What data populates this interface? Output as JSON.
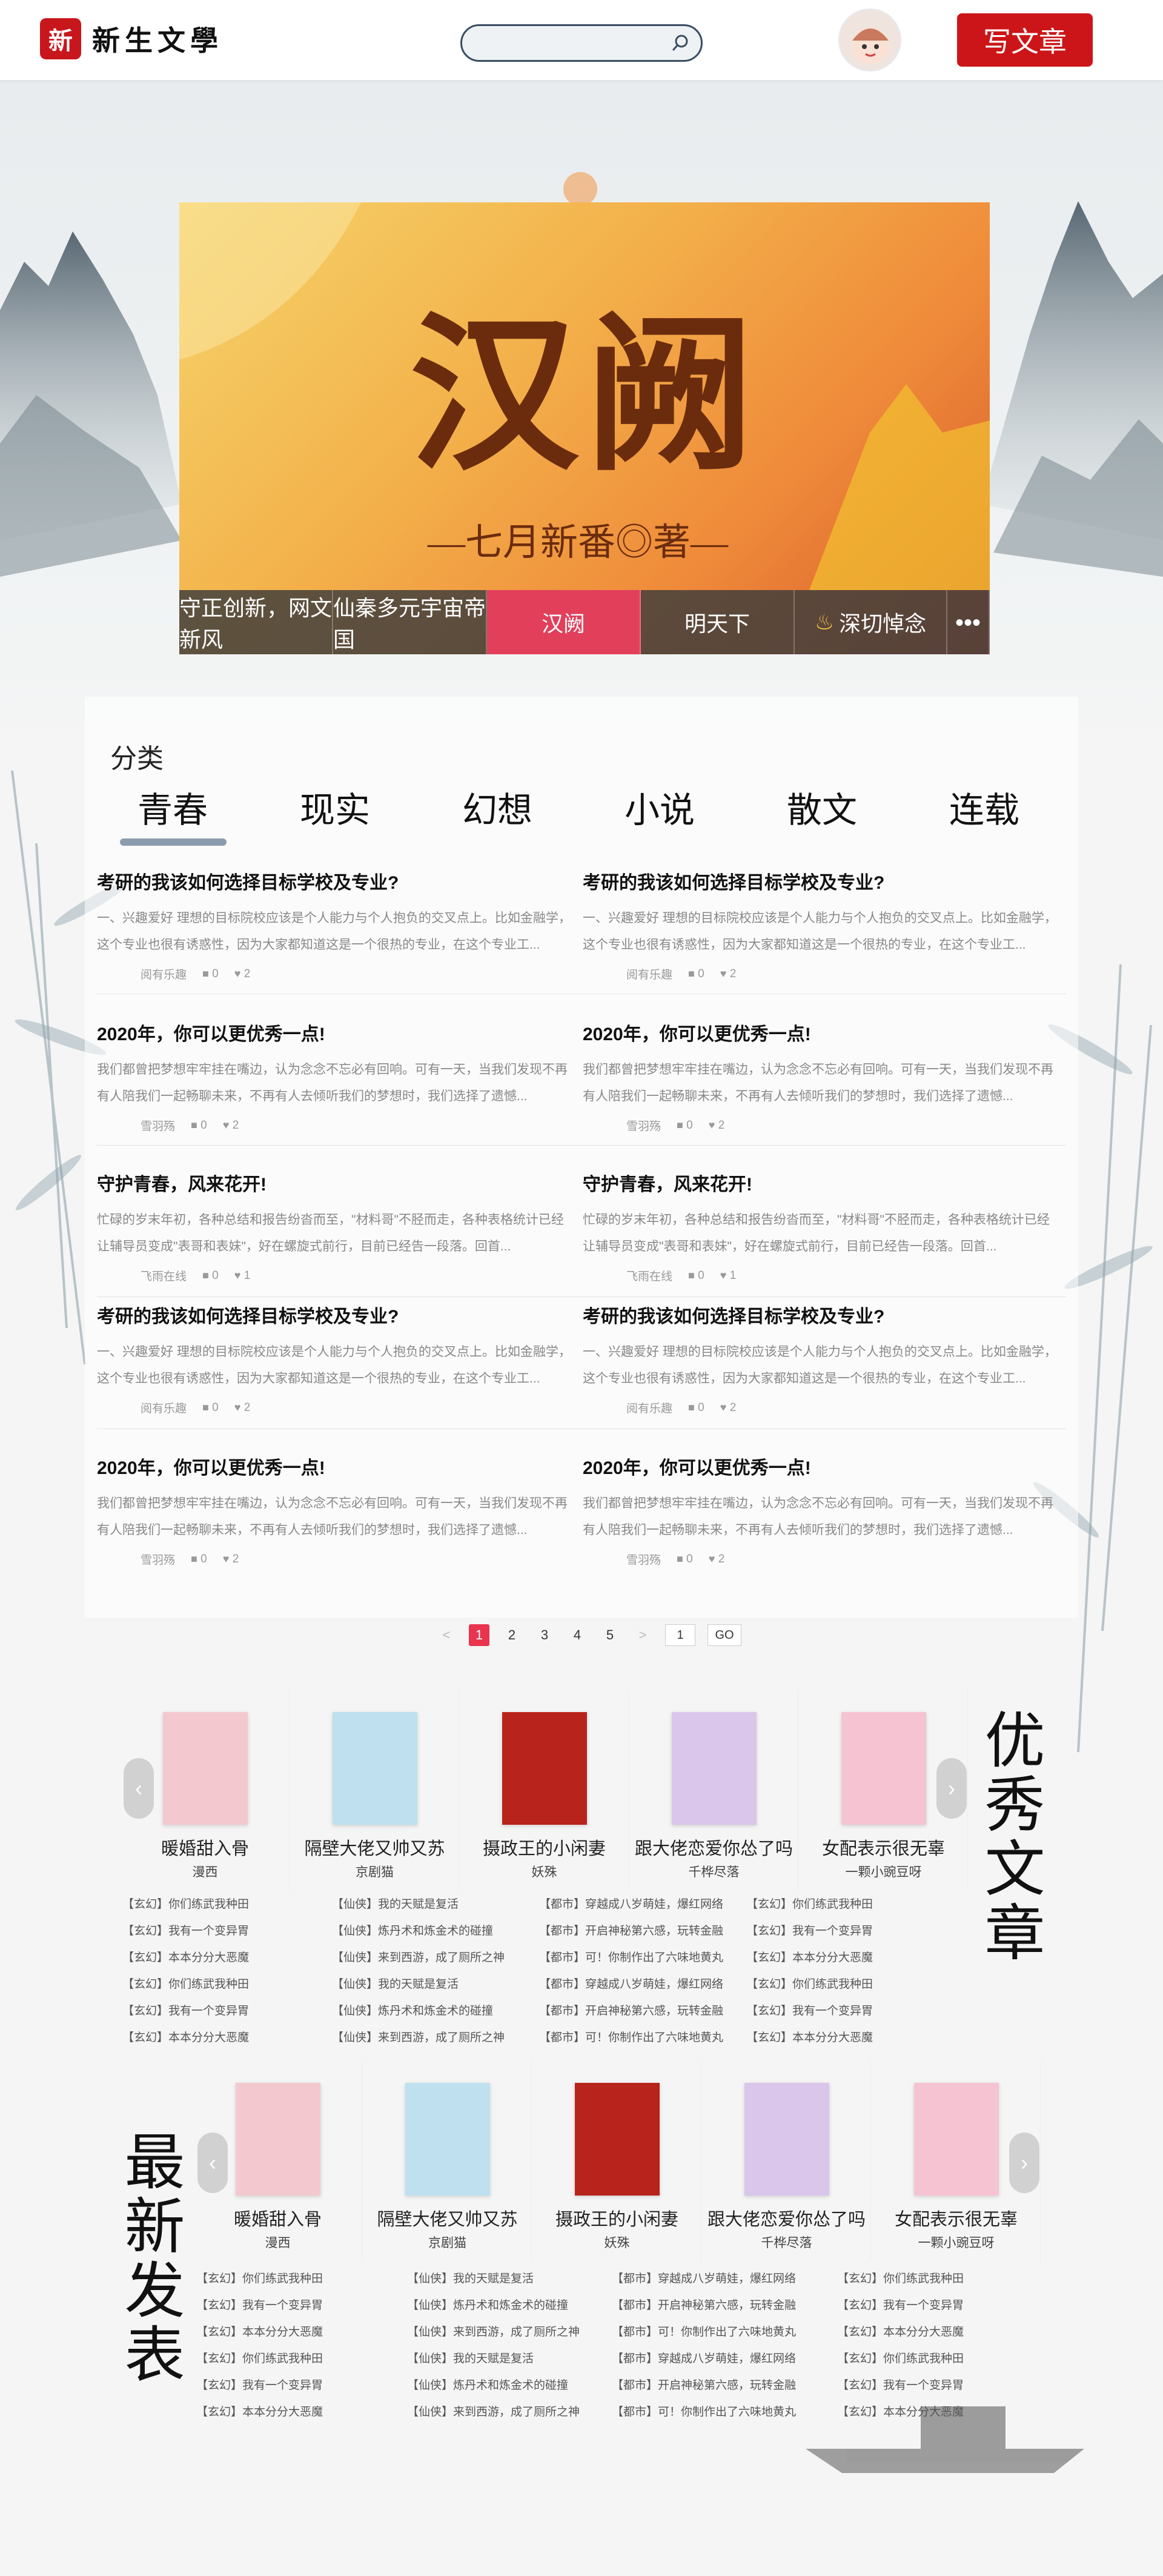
{
  "header": {
    "logo_seal": "新",
    "logo_text": "新生文學",
    "search_placeholder": "",
    "write_button": "写文章"
  },
  "banner": {
    "title": "汉阙",
    "subtitle": "—七月新番◎著—",
    "nav": [
      "守正创新，网文新风",
      "仙秦多元宇宙帝国",
      "汉阙",
      "明天下",
      "深切悼念",
      "•••"
    ]
  },
  "categories": {
    "title": "分类",
    "tabs": [
      "青春",
      "现实",
      "幻想",
      "小说",
      "散文",
      "连载"
    ],
    "articles": [
      {
        "title": "考研的我该如何选择目标学校及专业?",
        "desc": "一、兴趣爱好 理想的目标院校应该是个人能力与个人抱负的交叉点上。比如金融学，这个专业也很有诱惑性，因为大家都知道这是一个很热的专业，在这个专业工...",
        "author": "阅有乐趣",
        "likes": "0",
        "comments": "2"
      },
      {
        "title": "考研的我该如何选择目标学校及专业?",
        "desc": "一、兴趣爱好 理想的目标院校应该是个人能力与个人抱负的交叉点上。比如金融学，这个专业也很有诱惑性，因为大家都知道这是一个很热的专业，在这个专业工...",
        "author": "阅有乐趣",
        "likes": "0",
        "comments": "2"
      },
      {
        "title": "2020年，你可以更优秀一点!",
        "desc": "我们都曾把梦想牢牢挂在嘴边，认为念念不忘必有回响。可有一天，当我们发现不再有人陪我们一起畅聊未来，不再有人去倾听我们的梦想时，我们选择了遗憾...",
        "author": "雪羽殇",
        "likes": "0",
        "comments": "2"
      },
      {
        "title": "2020年，你可以更优秀一点!",
        "desc": "我们都曾把梦想牢牢挂在嘴边，认为念念不忘必有回响。可有一天，当我们发现不再有人陪我们一起畅聊未来，不再有人去倾听我们的梦想时，我们选择了遗憾...",
        "author": "雪羽殇",
        "likes": "0",
        "comments": "2"
      },
      {
        "title": "守护青春，风来花开!",
        "desc": "忙碌的岁末年初，各种总结和报告纷沓而至，\"材料哥\"不胫而走，各种表格统计已经让辅导员变成\"表哥和表妹\"，好在螺旋式前行，目前已经告一段落。回首...",
        "author": "飞雨在线",
        "likes": "0",
        "comments": "1"
      },
      {
        "title": "守护青春，风来花开!",
        "desc": "忙碌的岁末年初，各种总结和报告纷沓而至，\"材料哥\"不胫而走，各种表格统计已经让辅导员变成\"表哥和表妹\"，好在螺旋式前行，目前已经告一段落。回首...",
        "author": "飞雨在线",
        "likes": "0",
        "comments": "1"
      },
      {
        "title": "考研的我该如何选择目标学校及专业?",
        "desc": "一、兴趣爱好 理想的目标院校应该是个人能力与个人抱负的交叉点上。比如金融学，这个专业也很有诱惑性，因为大家都知道这是一个很热的专业，在这个专业工...",
        "author": "阅有乐趣",
        "likes": "0",
        "comments": "2"
      },
      {
        "title": "考研的我该如何选择目标学校及专业?",
        "desc": "一、兴趣爱好 理想的目标院校应该是个人能力与个人抱负的交叉点上。比如金融学，这个专业也很有诱惑性，因为大家都知道这是一个很热的专业，在这个专业工...",
        "author": "阅有乐趣",
        "likes": "0",
        "comments": "2"
      },
      {
        "title": "2020年，你可以更优秀一点!",
        "desc": "我们都曾把梦想牢牢挂在嘴边，认为念念不忘必有回响。可有一天，当我们发现不再有人陪我们一起畅聊未来，不再有人去倾听我们的梦想时，我们选择了遗憾...",
        "author": "雪羽殇",
        "likes": "0",
        "comments": "2"
      },
      {
        "title": "2020年，你可以更优秀一点!",
        "desc": "我们都曾把梦想牢牢挂在嘴边，认为念念不忘必有回响。可有一天，当我们发现不再有人陪我们一起畅聊未来，不再有人去倾听我们的梦想时，我们选择了遗憾...",
        "author": "雪羽殇",
        "likes": "0",
        "comments": "2"
      }
    ]
  },
  "pagination": {
    "pages": [
      "1",
      "2",
      "3",
      "4",
      "5"
    ],
    "current": "1",
    "prev": "<",
    "next": ">",
    "input_value": "1",
    "go": "GO"
  },
  "excellent": {
    "title": "优秀文章",
    "books": [
      {
        "title": "暖婚甜入骨",
        "author": "漫西"
      },
      {
        "title": "隔壁大佬又帅又苏",
        "author": "京剧猫"
      },
      {
        "title": "摄政王的小闲妻",
        "author": "妖殊"
      },
      {
        "title": "跟大佬恋爱你怂了吗",
        "author": "千桦尽落"
      },
      {
        "title": "女配表示很无辜",
        "author": "一颗小豌豆呀"
      }
    ],
    "tags": [
      [
        "【玄幻】你们练武我种田",
        "【玄幻】我有一个变异胃",
        "【玄幻】本本分分大恶魔",
        "【玄幻】你们练武我种田",
        "【玄幻】我有一个变异胃",
        "【玄幻】本本分分大恶魔"
      ],
      [
        "【仙侠】我的天赋是复活",
        "【仙侠】炼丹术和炼金术的碰撞",
        "【仙侠】来到西游，成了厕所之神",
        "【仙侠】我的天赋是复活",
        "【仙侠】炼丹术和炼金术的碰撞",
        "【仙侠】来到西游，成了厕所之神"
      ],
      [
        "【都市】穿越成八岁萌娃，爆红网络",
        "【都市】开启神秘第六感，玩转金融",
        "【都市】可！你制作出了六味地黄丸",
        "【都市】穿越成八岁萌娃，爆红网络",
        "【都市】开启神秘第六感，玩转金融",
        "【都市】可！你制作出了六味地黄丸"
      ],
      [
        "【玄幻】你们练武我种田",
        "【玄幻】我有一个变异胃",
        "【玄幻】本本分分大恶魔",
        "【玄幻】你们练武我种田",
        "【玄幻】我有一个变异胃",
        "【玄幻】本本分分大恶魔"
      ]
    ]
  },
  "latest": {
    "title": "最新发表",
    "books": [
      {
        "title": "暖婚甜入骨",
        "author": "漫西"
      },
      {
        "title": "隔壁大佬又帅又苏",
        "author": "京剧猫"
      },
      {
        "title": "摄政王的小闲妻",
        "author": "妖殊"
      },
      {
        "title": "跟大佬恋爱你怂了吗",
        "author": "千桦尽落"
      },
      {
        "title": "女配表示很无辜",
        "author": "一颗小豌豆呀"
      }
    ],
    "tags": [
      [
        "【玄幻】你们练武我种田",
        "【玄幻】我有一个变异胃",
        "【玄幻】本本分分大恶魔",
        "【玄幻】你们练武我种田",
        "【玄幻】我有一个变异胃",
        "【玄幻】本本分分大恶魔"
      ],
      [
        "【仙侠】我的天赋是复活",
        "【仙侠】炼丹术和炼金术的碰撞",
        "【仙侠】来到西游，成了厕所之神",
        "【仙侠】我的天赋是复活",
        "【仙侠】炼丹术和炼金术的碰撞",
        "【仙侠】来到西游，成了厕所之神"
      ],
      [
        "【都市】穿越成八岁萌娃，爆红网络",
        "【都市】开启神秘第六感，玩转金融",
        "【都市】可！你制作出了六味地黄丸",
        "【都市】穿越成八岁萌娃，爆红网络",
        "【都市】开启神秘第六感，玩转金融",
        "【都市】可！你制作出了六味地黄丸"
      ],
      [
        "【玄幻】你们练武我种田",
        "【玄幻】我有一个变异胃",
        "【玄幻】本本分分大恶魔",
        "【玄幻】你们练武我种田",
        "【玄幻】我有一个变异胃",
        "【玄幻】本本分分大恶魔"
      ]
    ]
  },
  "colors": {
    "brand_red": "#cc1518",
    "active_pink": "#e23f5b",
    "tab_underline": "#8b9cad"
  },
  "cover_colors": [
    "#f3c9cf",
    "#bfe0ee",
    "#b8231b",
    "#d9c6ea",
    "#f6c3d2"
  ]
}
